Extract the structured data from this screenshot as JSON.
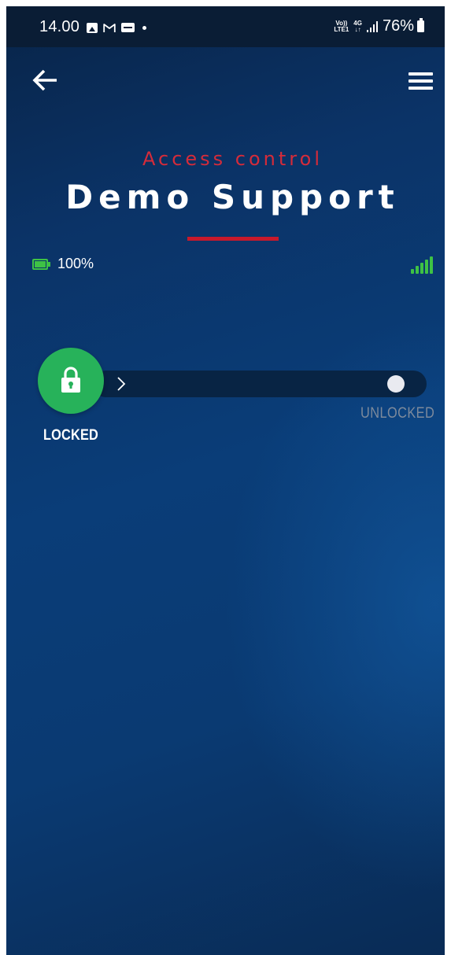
{
  "status_bar": {
    "time": "14.00",
    "volte_top": "Vo))",
    "volte_bottom": "LTE1",
    "network_type": "4G",
    "network_arrows": "↓↑",
    "battery_percent": "76%"
  },
  "header": {
    "back_icon": "arrow-left-icon",
    "menu_icon": "hamburger-menu-icon",
    "subtitle": "Access control",
    "title": "Demo Support"
  },
  "lock_status": {
    "battery_icon": "battery-icon",
    "battery_level": "100%",
    "signal_icon": "signal-strength-icon",
    "signal_bars_filled": 5,
    "signal_bars_total": 5
  },
  "slider": {
    "knob_icon": "padlock-icon",
    "direction_icon": "chevron-right-icon",
    "current_state_label": "LOCKED",
    "target_state_label": "UNLOCKED"
  },
  "colors": {
    "accent_red": "#d52b3a",
    "lock_green": "#27b25a",
    "indicator_green": "#3ec245",
    "status_bar_bg": "#0a1d35",
    "slider_track": "#082444",
    "unlocked_label": "#7d8a9c"
  }
}
